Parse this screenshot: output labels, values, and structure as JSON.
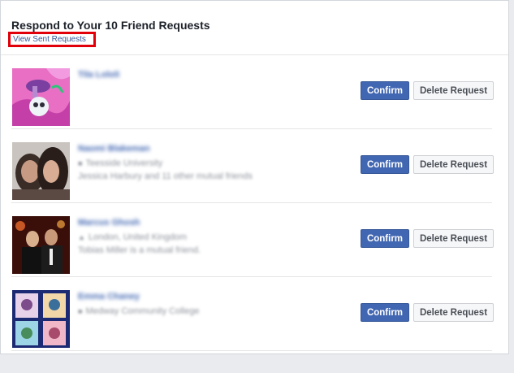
{
  "header": {
    "title": "Respond to Your 10 Friend Requests",
    "sent_link": "View Sent Requests"
  },
  "requests": [
    {
      "name": "Tila Lololi",
      "lines": [],
      "confirm_label": "Confirm",
      "delete_label": "Delete Request"
    },
    {
      "name": "Naomi Blakeman",
      "lines": [
        "Teesside University",
        "Jessica Harbury and 11 other mutual friends"
      ],
      "confirm_label": "Confirm",
      "delete_label": "Delete Request"
    },
    {
      "name": "Marcus Ghosh",
      "lines": [
        "London, United Kingdom",
        "Tobias Miller is a mutual friend."
      ],
      "confirm_label": "Confirm",
      "delete_label": "Delete Request"
    },
    {
      "name": "Emma Chaney",
      "lines": [
        "Medway Community College"
      ],
      "confirm_label": "Confirm",
      "delete_label": "Delete Request"
    }
  ],
  "icons": {
    "location": "location-pin-icon",
    "education": "education-icon"
  },
  "colors": {
    "brand_blue": "#4267b2",
    "link_blue": "#365899",
    "highlight_red": "#e1000a"
  }
}
